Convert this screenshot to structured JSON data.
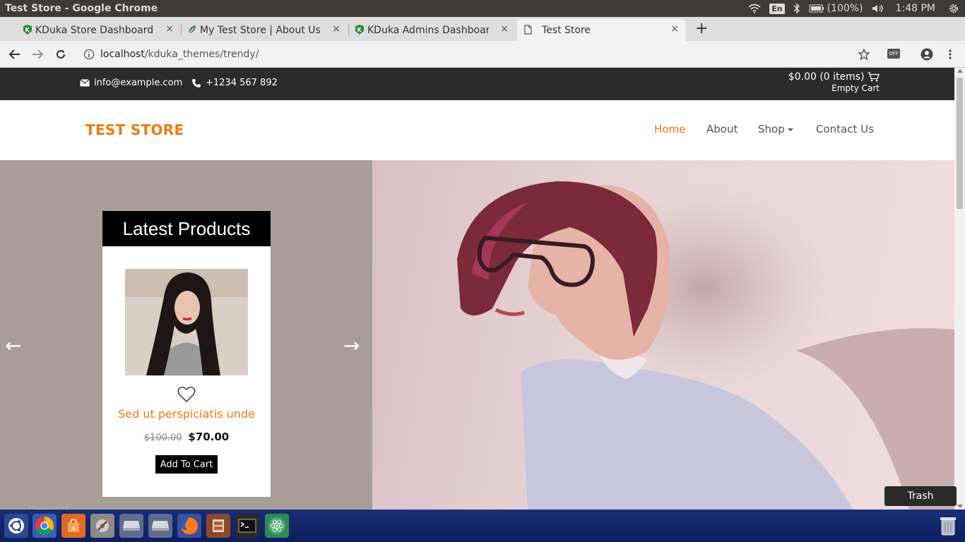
{
  "os": {
    "window_title": "Test Store - Google Chrome",
    "battery": "(100%)",
    "time": "1:48 PM",
    "keyboard": "En"
  },
  "tabs": [
    {
      "label": "KDuka Store Dashboard",
      "close": "×"
    },
    {
      "label": "My Test Store | About Us",
      "close": "×"
    },
    {
      "label": "KDuka Admins Dashboard",
      "close": "×"
    },
    {
      "label": "Test Store",
      "close": "×"
    }
  ],
  "newtab": "+",
  "address": {
    "host": "localhost",
    "path": "/kduka_themes/trendy/",
    "ext_badge": "OFF"
  },
  "topbar": {
    "email": "info@example.com",
    "phone": "+1234 567 892",
    "cart_summary": "$0.00 (0 items)",
    "cart_empty": "Empty Cart"
  },
  "header": {
    "brand": "TEST STORE",
    "nav": [
      "Home",
      "About",
      "Shop",
      "Contact Us"
    ]
  },
  "hero": {
    "prev": "←",
    "next": "→"
  },
  "latest": {
    "title": "Latest Products",
    "product_name": "Sed ut perspiciatis unde",
    "old_price": "$100.00",
    "new_price": "$70.00",
    "button": "Add To Cart"
  },
  "overlay": {
    "trash_tooltip": "Trash",
    "faint_text": "Carousel"
  },
  "colors": {
    "accent": "#f07a0e",
    "topbar_bg": "#2b2b2b",
    "launcher_bg": "#182e78"
  }
}
